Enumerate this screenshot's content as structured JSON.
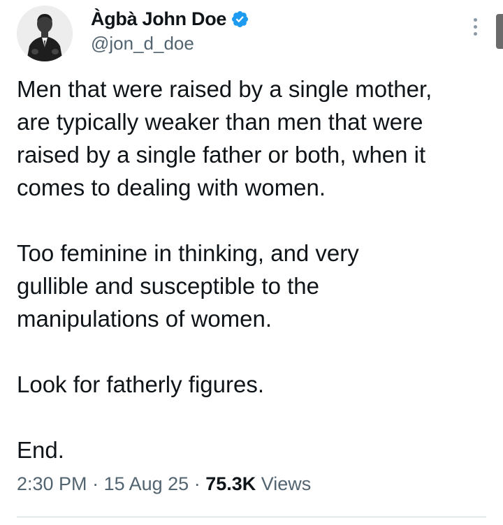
{
  "author": {
    "display_name": "Àgbà John Doe",
    "handle": "@jon_d_doe",
    "verified": true,
    "verified_color": "#1d9bf0",
    "avatar_icon": "profile-photo-grayscale"
  },
  "tweet": {
    "paragraphs": [
      "Men that were raised by a single mother,\nare typically weaker than men that were\nraised by a single father or both, when it\ncomes to dealing with women.",
      "Too feminine in thinking, and very\ngullible and susceptible to the\nmanipulations of women.",
      "Look for fatherly figures.",
      "End."
    ]
  },
  "meta": {
    "time": "2:30 PM",
    "sep1": " · ",
    "date": "15 Aug 25",
    "sep2": " · ",
    "views_count": "75.3K",
    "views_label": " Views"
  },
  "colors": {
    "text_primary": "#0f1419",
    "text_secondary": "#536471",
    "divider": "#cfd9de"
  },
  "icons": {
    "more": "more-vertical-icon",
    "verified": "verified-badge-icon"
  }
}
